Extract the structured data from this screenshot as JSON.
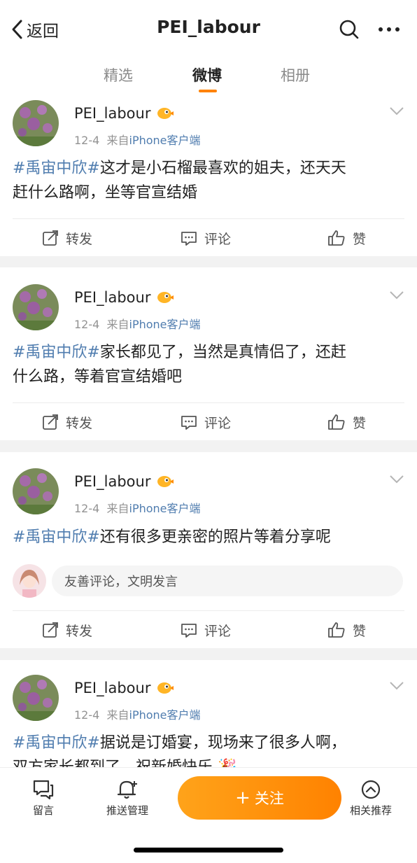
{
  "topbar": {
    "back_label": "返回",
    "title": "PEI_labour",
    "icons": [
      "chevron-left-icon",
      "search-icon",
      "more-icon"
    ]
  },
  "tabs": [
    {
      "label": "精选",
      "active": false
    },
    {
      "label": "微博",
      "active": true
    },
    {
      "label": "相册",
      "active": false
    }
  ],
  "posts": [
    {
      "username": "PEI_labour",
      "date": "12-4",
      "source_prefix": "来自",
      "source": "iPhone客户端",
      "hashtag": "#禹宙中欣#",
      "text_line1": "这才是小石榴最喜欢的姐夫，还天天",
      "text_line2": "赶什么路啊，坐等官宣结婚",
      "actions": {
        "forward": "转发",
        "comment": "评论",
        "like": "赞"
      }
    },
    {
      "username": "PEI_labour",
      "date": "12-4",
      "source_prefix": "来自",
      "source": "iPhone客户端",
      "hashtag": "#禹宙中欣#",
      "text_line1": "家长都见了，当然是真情侣了，还赶",
      "text_line2": "什么路，等着官宣结婚吧",
      "actions": {
        "forward": "转发",
        "comment": "评论",
        "like": "赞"
      }
    },
    {
      "username": "PEI_labour",
      "date": "12-4",
      "source_prefix": "来自",
      "source": "iPhone客户端",
      "hashtag": "#禹宙中欣#",
      "text_line1": "还有很多更亲密的照片等着分享呢",
      "comment_placeholder": "友善评论，文明发言",
      "actions": {
        "forward": "转发",
        "comment": "评论",
        "like": "赞"
      }
    },
    {
      "username": "PEI_labour",
      "date": "12-4",
      "source_prefix": "来自",
      "source": "iPhone客户端",
      "hashtag": "#禹宙中欣#",
      "text_line1": "据说是订婚宴，现场来了很多人啊，",
      "text_line2": "双方家长都到了，祝新婚快乐"
    }
  ],
  "bottombar": {
    "message": "留言",
    "push": "推送管理",
    "follow": "关注",
    "related": "相关推荐"
  },
  "colors": {
    "accent": "#ff8200",
    "link": "#507daf",
    "meta": "#939393"
  }
}
